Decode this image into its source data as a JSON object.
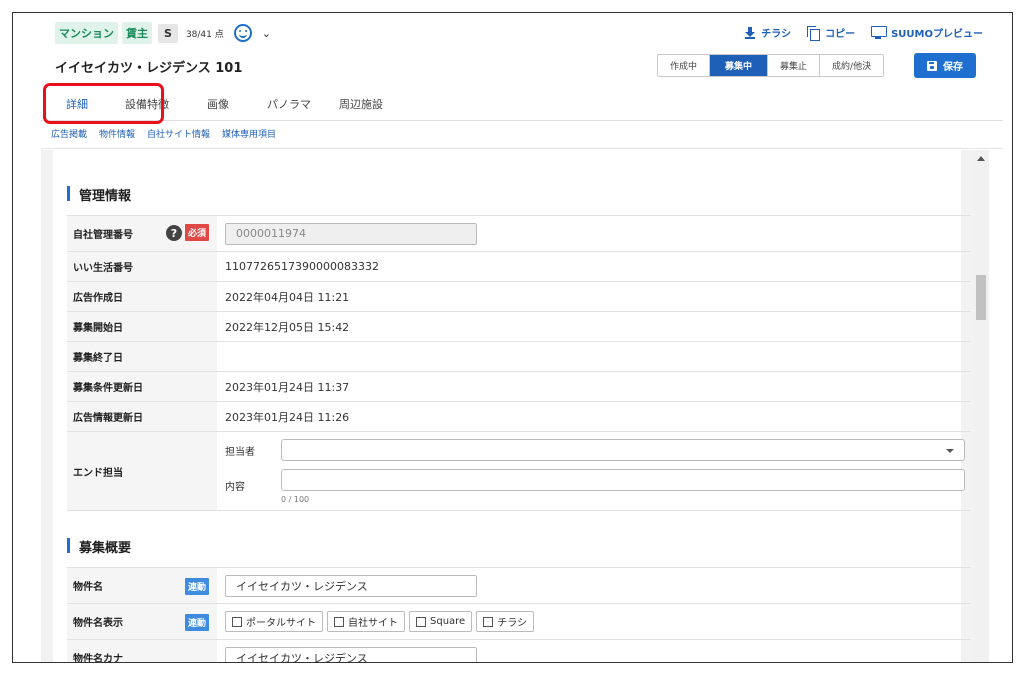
{
  "header": {
    "tags": [
      "マンション",
      "賃主"
    ],
    "grade": "S",
    "score": "38/41 点",
    "actions": [
      "チラシ",
      "コピー",
      "SUUMOプレビュー"
    ],
    "title": "イイセイカツ・レジデンス 101",
    "statuses": [
      "作成中",
      "募集中",
      "募集止",
      "成約/他決"
    ],
    "active_status": "募集中",
    "save_label": "保存"
  },
  "tabs": [
    "詳細",
    "設備特徴",
    "画像",
    "パノラマ",
    "周辺施設"
  ],
  "active_tab": "詳細",
  "subnav": [
    "広告掲載",
    "物件情報",
    "自社サイト情報",
    "媒体専用項目"
  ],
  "management": {
    "title": "管理情報",
    "required_label": "必須",
    "help_glyph": "?",
    "rows": [
      {
        "label": "自社管理番号",
        "value": "0000011974"
      },
      {
        "label": "いい生活番号",
        "value": "1107726517390000083332"
      },
      {
        "label": "広告作成日",
        "value": "2022年04月04日 11:21"
      },
      {
        "label": "募集開始日",
        "value": "2022年12月05日 15:42"
      },
      {
        "label": "募集終了日",
        "value": ""
      },
      {
        "label": "募集条件更新日",
        "value": "2023年01月24日 11:37"
      },
      {
        "label": "広告情報更新日",
        "value": "2023年01月24日 11:26"
      }
    ],
    "end_contact": {
      "label": "エンド担当",
      "person_label": "担当者",
      "person_value": "",
      "content_label": "内容",
      "content_value": "",
      "counter": "0 / 100"
    }
  },
  "recruit": {
    "title": "募集概要",
    "link_label": "連動",
    "name_label": "物件名",
    "name_value": "イイセイカツ・レジデンス",
    "display_label": "物件名表示",
    "display_options": [
      "ポータルサイト",
      "自社サイト",
      "Square",
      "チラシ"
    ],
    "kana_label": "物件名カナ",
    "kana_value": "イイセイカツ・レジデンス"
  }
}
